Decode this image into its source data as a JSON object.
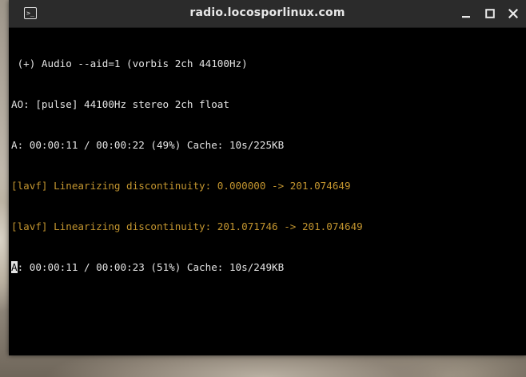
{
  "window": {
    "title": "radio.locosporlinux.com",
    "icon": "terminal-icon",
    "controls": [
      "minimize-icon",
      "maximize-icon",
      "close-icon"
    ]
  },
  "terminal": {
    "lines": [
      " (+) Audio --aid=1 (vorbis 2ch 44100Hz)",
      "AO: [pulse] 44100Hz stereo 2ch float",
      "A: 00:00:11 / 00:00:22 (49%) Cache: 10s/225KB",
      "[lavf] Linearizing discontinuity: 0.000000 -> 201.074649",
      "[lavf] Linearizing discontinuity: 201.071746 -> 201.074649"
    ],
    "cursor_char": "A",
    "last_line_rest": ": 00:00:11 / 00:00:23 (51%) Cache: 10s/249KB",
    "colors": {
      "text": "#e4e4e4",
      "warning": "#c3952f",
      "background": "#000000"
    }
  }
}
